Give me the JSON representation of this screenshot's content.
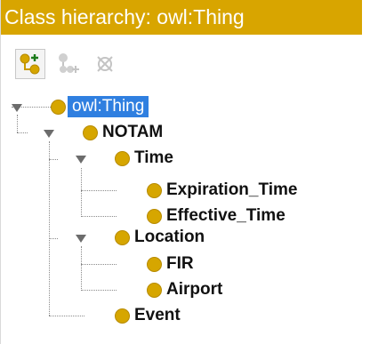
{
  "window": {
    "title": "Class hierarchy: owl:Thing"
  },
  "toolbar": {
    "buttons": [
      {
        "name": "add-subclass",
        "icon": "add-subclass-icon",
        "enabled": true
      },
      {
        "name": "add-sibling",
        "icon": "add-sibling-icon",
        "enabled": false
      },
      {
        "name": "delete-class",
        "icon": "delete-class-icon",
        "enabled": false
      }
    ]
  },
  "tree": {
    "root": "owl:Thing",
    "nodes": {
      "notam": "NOTAM",
      "time": "Time",
      "expiration_time": "Expiration_Time",
      "effective_time": "Effective_Time",
      "location": "Location",
      "fir": "FIR",
      "airport": "Airport",
      "event": "Event"
    }
  },
  "colors": {
    "title_bar": "#d8a500",
    "class_dot": "#d6a600",
    "selection": "#2f7fe0"
  }
}
